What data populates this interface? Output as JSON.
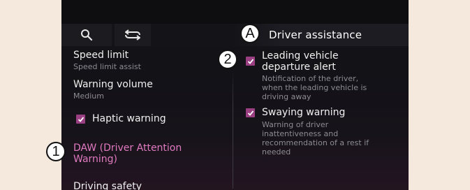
{
  "header": {
    "title": "Driver assistance",
    "search_icon": "search-icon",
    "swap_icon": "swap-arrows-icon"
  },
  "left_menu": {
    "speed_limit": {
      "label": "Speed limit",
      "value": "Speed limit assist"
    },
    "warning_volume": {
      "label": "Warning volume",
      "value": "Medium"
    },
    "haptic_warning": {
      "label": "Haptic warning",
      "checked": true
    },
    "daw": {
      "line1": "DAW (Driver Attention",
      "line2": "Warning)"
    },
    "driving_safety": {
      "label": "Driving safety"
    }
  },
  "right_panel": {
    "leading_vehicle": {
      "line1": "Leading vehicle",
      "line2": "departure alert",
      "checked": true,
      "desc1": "Notification of the driver,",
      "desc2": "when the leading vehicle is",
      "desc3": "driving away"
    },
    "swaying": {
      "label": "Swaying warning",
      "checked": true,
      "desc1": "Warning of driver",
      "desc2": "inattentiveness and",
      "desc3": "recommendation of a rest if",
      "desc4": "needed"
    }
  },
  "callouts": {
    "a": "A",
    "one": "1",
    "two": "2"
  },
  "colors": {
    "accent": "#e07ac0",
    "checkbox": "#9a3f82",
    "background": "#121217",
    "page": "#f4e9dc"
  }
}
